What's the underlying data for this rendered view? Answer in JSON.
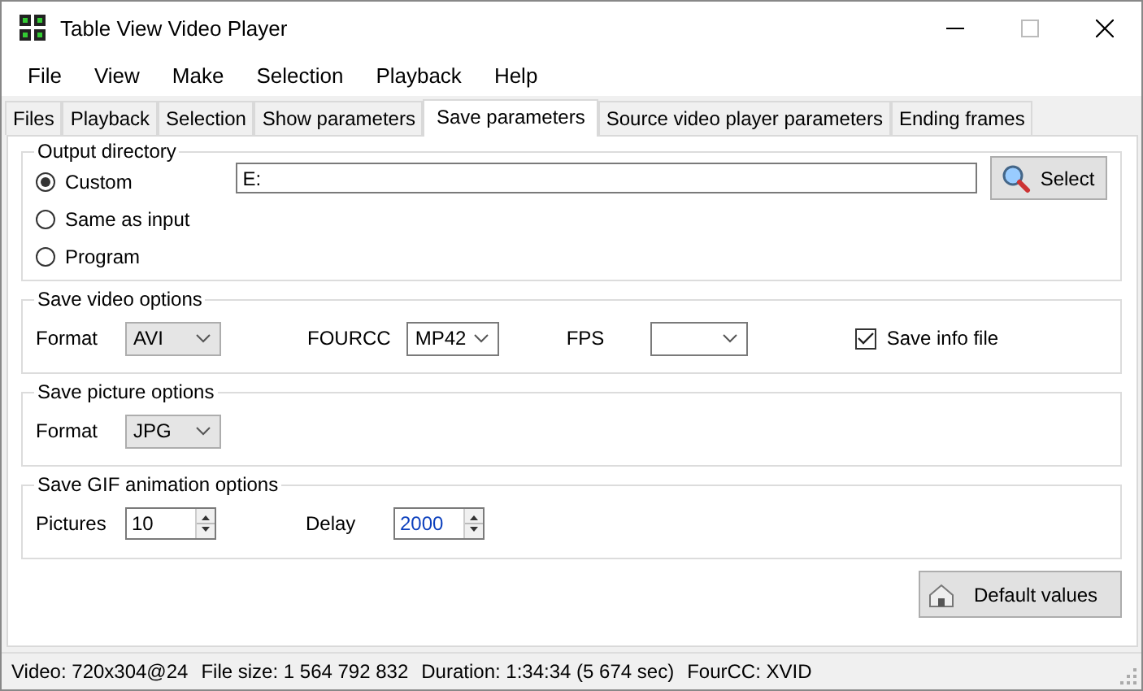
{
  "window": {
    "title": "Table View Video Player"
  },
  "menu": [
    "File",
    "View",
    "Make",
    "Selection",
    "Playback",
    "Help"
  ],
  "tabs": [
    {
      "label": "Files",
      "selected": false
    },
    {
      "label": "Playback",
      "selected": false
    },
    {
      "label": "Selection",
      "selected": false
    },
    {
      "label": "Show parameters",
      "selected": false
    },
    {
      "label": "Save parameters",
      "selected": true
    },
    {
      "label": "Source video player parameters",
      "selected": false
    },
    {
      "label": "Ending frames",
      "selected": false
    }
  ],
  "output_directory": {
    "title": "Output directory",
    "options": [
      {
        "label": "Custom",
        "selected": true
      },
      {
        "label": "Same as input",
        "selected": false
      },
      {
        "label": "Program",
        "selected": false
      }
    ],
    "path": "E:",
    "select_button": "Select"
  },
  "save_video_options": {
    "title": "Save video options",
    "format_label": "Format",
    "format": "AVI",
    "fourcc_label": "FOURCC",
    "fourcc": "MP42",
    "fps_label": "FPS",
    "save_info_file": {
      "label": "Save info file",
      "checked": true
    }
  },
  "save_picture_options": {
    "title": "Save picture options",
    "format_label": "Format",
    "format": "JPG"
  },
  "save_gif_options": {
    "title": "Save GIF animation options",
    "pictures_label": "Pictures",
    "pictures": "10",
    "delay_label": "Delay",
    "delay": "2000"
  },
  "default_button": "Default values",
  "status_bar": [
    "Video: 720x304@24",
    "File size: 1 564 792 832",
    "Duration: 1:34:34 (5 674 sec)",
    "FourCC: XVID"
  ]
}
